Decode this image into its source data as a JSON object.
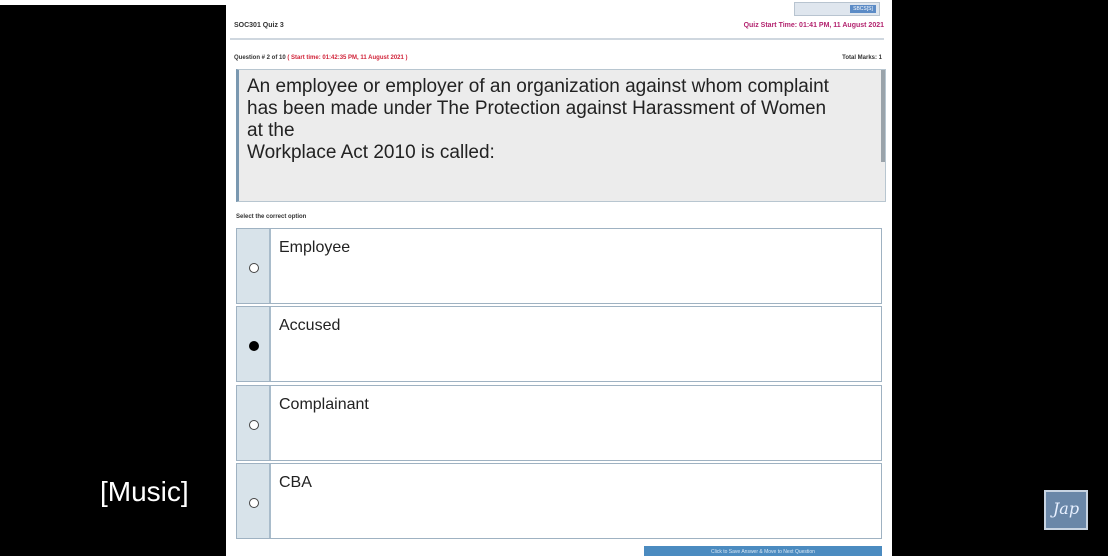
{
  "top_button": {
    "label": "SBCS[S]"
  },
  "quiz": {
    "title": "SOC301 Quiz 3",
    "start_time": "Quiz Start Time: 01:41 PM, 11 August 2021"
  },
  "question": {
    "number_label": "Question # 2 of 10",
    "start_time": "( Start time: 01:42:35 PM, 11 August 2021 )",
    "total_marks": "Total Marks: 1",
    "text": "An employee or employer of an organization against whom complaint\nhas been made under The Protection against Harassment of Women\nat the\nWorkplace Act 2010 is called:"
  },
  "select_label": "Select the correct option",
  "options": [
    {
      "label": "Employee",
      "checked": false
    },
    {
      "label": "Accused",
      "checked": true
    },
    {
      "label": "Complainant",
      "checked": false
    },
    {
      "label": "CBA",
      "checked": false
    }
  ],
  "next_button": "Click to Save Answer & Move to Next Question",
  "caption": "[Music]",
  "logo_text": "Jap"
}
